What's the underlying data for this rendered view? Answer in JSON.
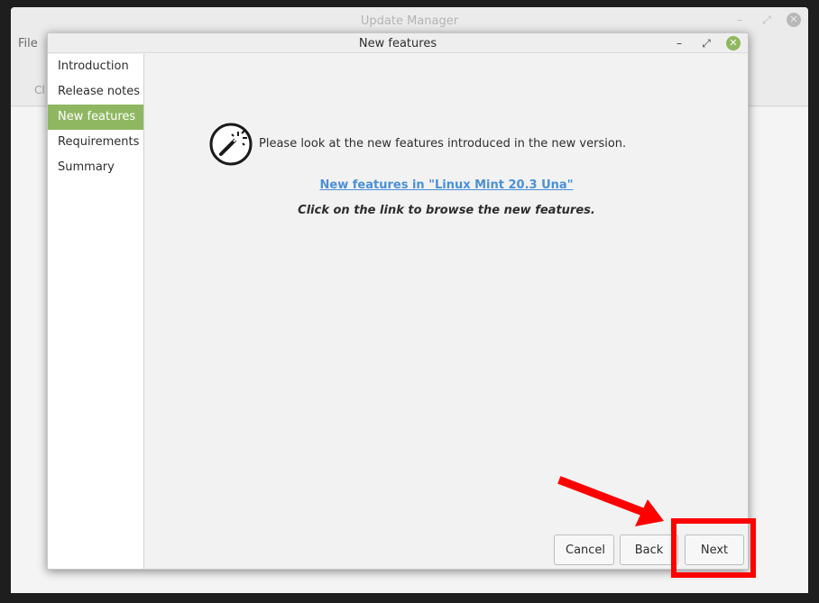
{
  "background_window": {
    "title": "Update Manager",
    "menu_file": "File",
    "toolbar_partial_label": "Cl"
  },
  "dialog": {
    "title": "New features",
    "sidebar": {
      "items": [
        {
          "label": "Introduction",
          "active": false
        },
        {
          "label": "Release notes",
          "active": false
        },
        {
          "label": "New features",
          "active": true
        },
        {
          "label": "Requirements",
          "active": false
        },
        {
          "label": "Summary",
          "active": false
        }
      ]
    },
    "content": {
      "icon": "magic-wand-icon",
      "intro": "Please look at the new features introduced in the new version.",
      "link": "New features in \"Linux Mint 20.3 Una\"",
      "hint": "Click on the link to browse the new features."
    },
    "buttons": {
      "cancel": "Cancel",
      "back": "Back",
      "next": "Next"
    }
  },
  "colors": {
    "accent_green": "#8fb761",
    "link_blue": "#4a90d9",
    "annotation_red": "#ff0000"
  }
}
